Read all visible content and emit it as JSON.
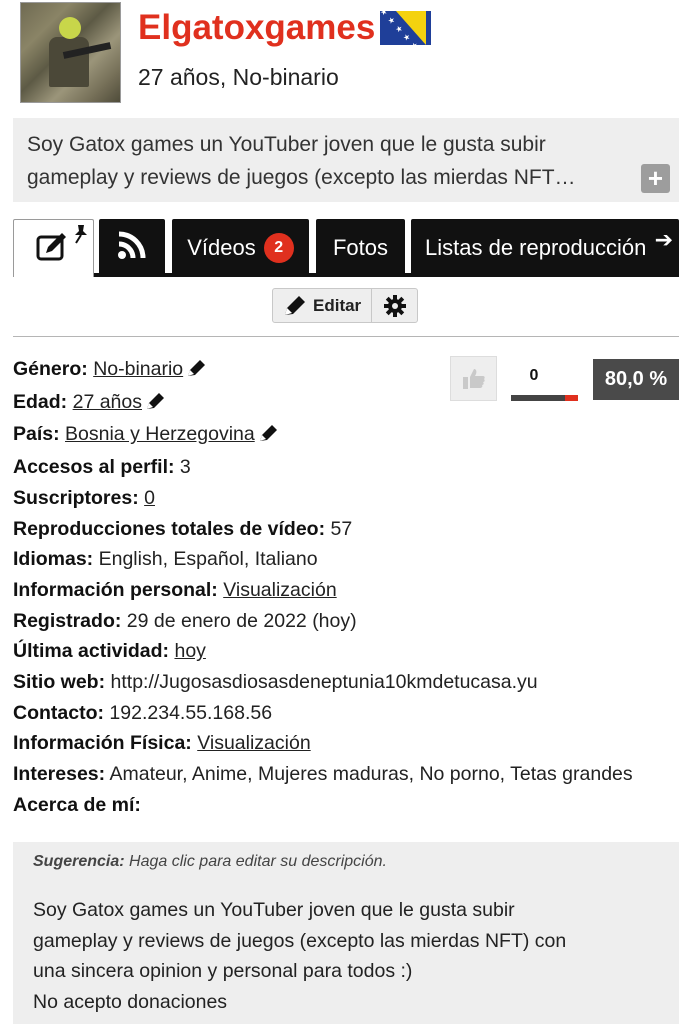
{
  "profile": {
    "username": "Elgatoxgames",
    "subline": "27 años, No-binario",
    "flag_country": "Bosnia y Herzegovina",
    "short_description_lines": [
      "Soy Gatox games un YouTuber joven que le gusta subir",
      "gameplay y reviews de juegos (excepto las mierdas NFT…"
    ],
    "expand_icon": "plus-icon"
  },
  "tabs": [
    {
      "label": "",
      "icon": "edit-pin-icon",
      "active": true
    },
    {
      "label": "",
      "icon": "rss-icon",
      "active": false
    },
    {
      "label": "Vídeos",
      "badge": "2",
      "active": false
    },
    {
      "label": "Fotos",
      "active": false
    },
    {
      "label": "Listas de reproducción",
      "active": false
    }
  ],
  "toolbar": {
    "edit_label": "Editar"
  },
  "rating": {
    "likes": "0",
    "like_fraction": 0.8,
    "percent": "80,0 %"
  },
  "fields": {
    "gender": {
      "label": "Género:",
      "value": "No-binario"
    },
    "age": {
      "label": "Edad:",
      "value": "27 años"
    },
    "country": {
      "label": "País:",
      "value": "Bosnia y Herzegovina"
    },
    "views": {
      "label": "Accesos al perfil:",
      "value": "3"
    },
    "subscribers": {
      "label": "Suscriptores:",
      "value": "0"
    },
    "total_plays": {
      "label": "Reproducciones totales de vídeo:",
      "value": "57"
    },
    "languages": {
      "label": "Idiomas:",
      "value": "English, Español, Italiano"
    },
    "personal_info": {
      "label": "Información personal:",
      "value": "Visualización"
    },
    "registered": {
      "label": "Registrado:",
      "value": "29 de enero de 2022 (hoy)"
    },
    "last_activity": {
      "label": "Última actividad:",
      "value": "hoy"
    },
    "website": {
      "label": "Sitio web:",
      "value": "http://Jugosasdiosasdeneptunia10kmdetucasa.yu"
    },
    "contact": {
      "label": "Contacto:",
      "value": "192.234.55.168.56"
    },
    "physical_info": {
      "label": "Información Física:",
      "value": "Visualización"
    },
    "interests": {
      "label": "Intereses:",
      "value": "Amateur, Anime, Mujeres maduras, No porno, Tetas grandes"
    },
    "about": {
      "label": "Acerca de mí:"
    }
  },
  "about": {
    "hint_label": "Sugerencia:",
    "hint_text": "Haga clic para editar su descripción.",
    "lines": [
      "Soy Gatox games un YouTuber joven que le gusta subir",
      "gameplay y reviews de juegos (excepto las mierdas NFT) con",
      "una sincera opinion y personal para todos :)",
      "No acepto donaciones"
    ]
  },
  "colors": {
    "brand": "#e0301e",
    "tab_bg": "#111111",
    "panel_bg": "#eeeeee",
    "rating_bg": "#4a4a4a"
  }
}
